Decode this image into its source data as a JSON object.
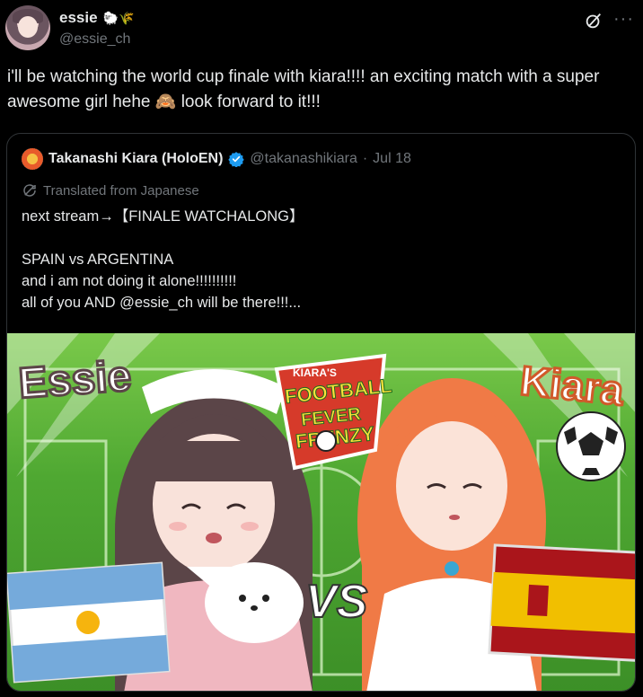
{
  "author": {
    "display_name": "essie",
    "name_emojis": "🐑🌾",
    "handle": "@essie_ch"
  },
  "tweet": {
    "text": "i'll be watching the world cup finale with kiara!!!! an exciting match with a super awesome girl hehe 🙈 look forward to it!!!"
  },
  "quote": {
    "display_name": "Takanashi Kiara (HoloEN)",
    "handle": "@takanashikiara",
    "separator": "·",
    "date": "Jul 18",
    "translated_label": "Translated from Japanese",
    "text": "next stream→【FINALE WATCHALONG】\n\nSPAIN vs ARGENTINA\nand i am not doing it alone!!!!!!!!!!\nall of you AND @essie_ch will be there!!!..."
  },
  "media": {
    "left_name": "Essie",
    "right_name": "Kiara",
    "logo_top": "KIARA'S",
    "logo_line1": "FOOTBALL",
    "logo_line2": "FEVER",
    "logo_line3": "FRENZY",
    "vs": "VS"
  },
  "icons": {
    "grok": "grok-icon",
    "more": "more-icon",
    "verified": "verified-badge-icon",
    "translate": "translate-icon"
  },
  "colors": {
    "background": "#000000",
    "text": "#e7e9ea",
    "secondary": "#71767b",
    "border": "#2f3336",
    "verified": "#1d9bf0"
  }
}
